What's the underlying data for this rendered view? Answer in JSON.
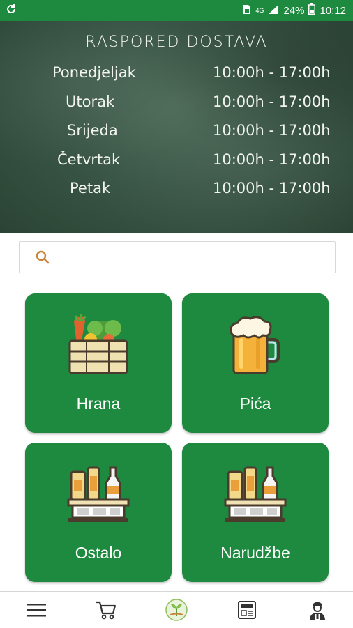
{
  "status_bar": {
    "battery_percent": "24%",
    "time": "10:12",
    "network": "4G"
  },
  "schedule": {
    "title": "RASPORED DOSTAVA",
    "rows": [
      {
        "day": "Ponedjeljak",
        "hours": "10:00h - 17:00h"
      },
      {
        "day": "Utorak",
        "hours": "10:00h - 17:00h"
      },
      {
        "day": "Srijeda",
        "hours": "10:00h - 17:00h"
      },
      {
        "day": "Četvrtak",
        "hours": "10:00h - 17:00h"
      },
      {
        "day": "Petak",
        "hours": "10:00h - 17:00h"
      }
    ]
  },
  "search": {
    "placeholder": "",
    "value": ""
  },
  "categories": [
    {
      "label": "Hrana",
      "icon": "vegetable-crate-icon"
    },
    {
      "label": "Pića",
      "icon": "beer-mug-icon"
    },
    {
      "label": "Ostalo",
      "icon": "grocery-shelf-icon"
    },
    {
      "label": "Narudžbe",
      "icon": "grocery-shelf-icon"
    }
  ],
  "bottom_nav": [
    "menu-icon",
    "cart-icon",
    "home-logo-icon",
    "news-icon",
    "profile-icon"
  ],
  "colors": {
    "primary": "#1e8a3f",
    "search_icon": "#c9823b",
    "chalk": "#f1f3ef"
  }
}
